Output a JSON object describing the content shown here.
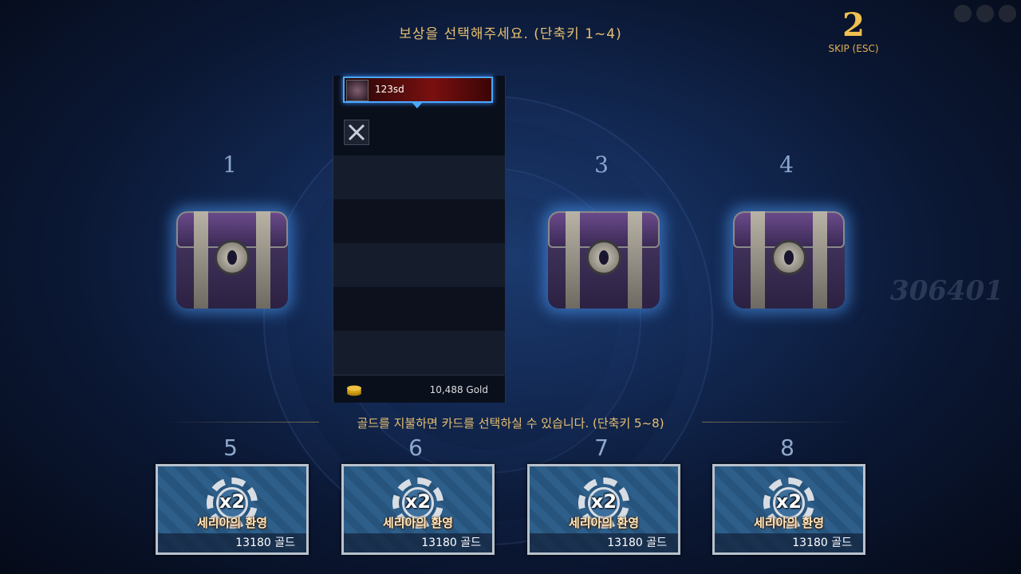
{
  "prompt": {
    "title": "보상을 선택해주세요. (단축키 1~4)",
    "pay_text": "골드를 지불하면 카드를 선택하실 수 있습니다. (단축키 5~8)"
  },
  "timer": {
    "count": "2",
    "skip_label": "SKIP (ESC)"
  },
  "chests": [
    {
      "number": "1"
    },
    {
      "number": "3"
    },
    {
      "number": "4"
    }
  ],
  "selected_panel": {
    "player_name": "123sd",
    "gold": "10,488 Gold"
  },
  "cards": [
    {
      "number": "5",
      "multiplier": "x2",
      "name": "세리아의 환영",
      "price": "13180 골드"
    },
    {
      "number": "6",
      "multiplier": "x2",
      "name": "세리아의 환영",
      "price": "13180 골드"
    },
    {
      "number": "7",
      "multiplier": "x2",
      "name": "세리아의 환영",
      "price": "13180 골드"
    },
    {
      "number": "8",
      "multiplier": "x2",
      "name": "세리아의 환영",
      "price": "13180 골드"
    }
  ],
  "background_score": "306401",
  "colors": {
    "accent_gold": "#e8c070",
    "chest_glow": "#50a0ff",
    "player_bar": "#7a1010"
  }
}
